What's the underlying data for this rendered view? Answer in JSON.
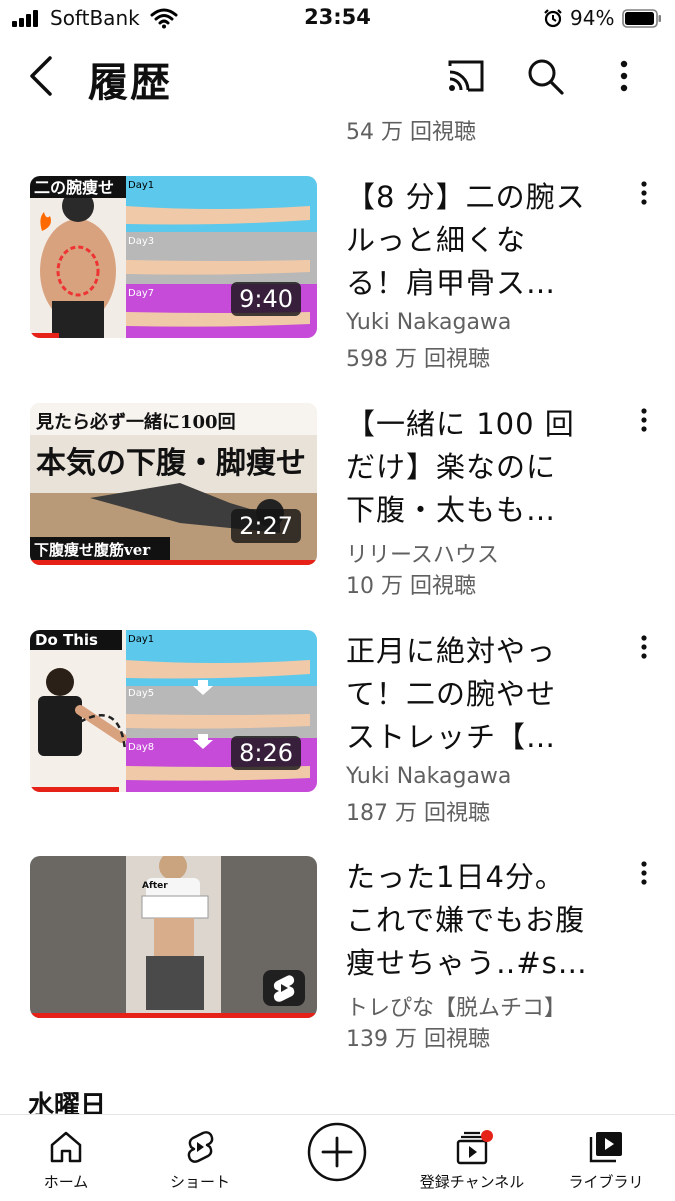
{
  "status_bar": {
    "carrier": "SoftBank",
    "time": "23:54",
    "battery": "94%"
  },
  "header": {
    "title": "履歴",
    "icons": [
      "back-icon",
      "cast-icon",
      "search-icon",
      "more-vert-icon"
    ]
  },
  "prev_item": {
    "views": "54 万 回視聴"
  },
  "videos": [
    {
      "title_lines": [
        "【8 分】二の腕ス",
        "ルっと細くな",
        "る！肩甲骨ス…"
      ],
      "channel": "Yuki Nakagawa",
      "views": "598 万 回視聴",
      "duration": "9:40",
      "thumb_text": [
        "二の腕痩せ",
        "Day1",
        "Day3",
        "Day7"
      ],
      "watched_fraction": 0.1
    },
    {
      "title_lines": [
        "【一緒に 100 回",
        "だけ】楽なのに",
        "下腹・太もも…"
      ],
      "channel": "リリースハウス",
      "views": "10 万 回視聴",
      "duration": "2:27",
      "thumb_text": [
        "見たら必ず一緒に100回",
        "本気の下腹・脚痩せ",
        "下腹痩せ腹筋ver"
      ],
      "watched_fraction": 1.0
    },
    {
      "title_lines": [
        "正月に絶対やっ",
        "て！二の腕やせ",
        "ストレッチ【…"
      ],
      "channel": "Yuki Nakagawa",
      "views": "187 万 回視聴",
      "duration": "8:26",
      "thumb_text": [
        "Do This",
        "Day1",
        "Day5",
        "Day8"
      ],
      "watched_fraction": 0.31
    },
    {
      "title_lines": [
        "たった1日4分。",
        "これで嫌でもお腹",
        "痩せちゃう‥#s…"
      ],
      "channel": "トレぴな【脱ムチコ】",
      "views": "139 万 回視聴",
      "duration": "",
      "thumb_text": [
        "After"
      ],
      "watched_fraction": 1.0
    }
  ],
  "section_header": "水曜日",
  "tab_bar": [
    {
      "label": "ホーム",
      "icon": "home-icon"
    },
    {
      "label": "ショート",
      "icon": "shorts-icon"
    },
    {
      "label": "",
      "icon": "create-icon"
    },
    {
      "label": "登録チャンネル",
      "icon": "subscriptions-icon"
    },
    {
      "label": "ライブラリ",
      "icon": "library-icon"
    }
  ],
  "colors": {
    "accent_red": "#e62117",
    "text_primary": "#0f0f0f",
    "text_secondary": "#606060"
  }
}
